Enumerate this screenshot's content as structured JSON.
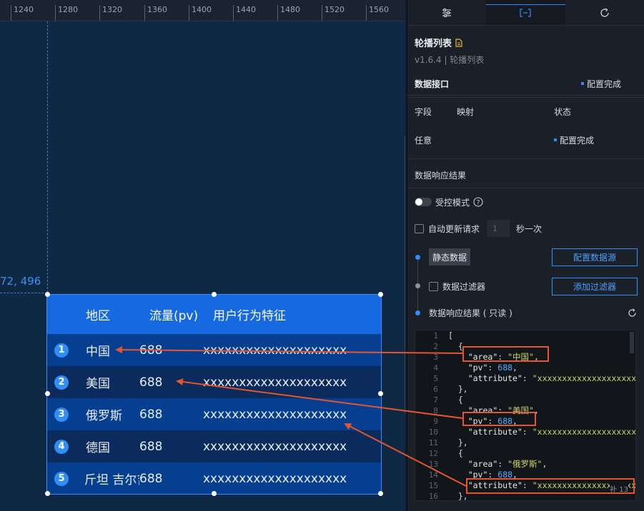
{
  "ruler": {
    "ticks": [
      "1240",
      "1280",
      "1320",
      "1360",
      "1400",
      "1440",
      "1480",
      "1520",
      "1560"
    ]
  },
  "canvas": {
    "coordinate_readout": "72, 496"
  },
  "carousel": {
    "headers": {
      "area": "地区",
      "pv": "流量(pv)",
      "attribute": "用户行为特征"
    },
    "rows": [
      {
        "index": "1",
        "area": "中国",
        "pv": "688",
        "attribute": "xxxxxxxxxxxxxxxxxxxx"
      },
      {
        "index": "2",
        "area": "美国",
        "pv": "688",
        "attribute": "xxxxxxxxxxxxxxxxxxxx"
      },
      {
        "index": "3",
        "area": "俄罗斯",
        "pv": "688",
        "attribute": "xxxxxxxxxxxxxxxxxxxx"
      },
      {
        "index": "4",
        "area": "德国",
        "pv": "688",
        "attribute": "xxxxxxxxxxxxxxxxxxxx"
      },
      {
        "index": "5",
        "area": "斤坦 吉尔吉",
        "pv": "688",
        "attribute": "xxxxxxxxxxxxxxxxxxxx"
      }
    ]
  },
  "panel": {
    "tabs": [
      {
        "name": "sliders-icon"
      },
      {
        "name": "data-bracket-icon",
        "active": true
      },
      {
        "name": "interaction-icon"
      }
    ],
    "component_title": "轮播列表",
    "component_subtitle": "v1.6.4 | 轮播列表",
    "data_interface": {
      "label": "数据接口",
      "status": "配置完成"
    },
    "field_table": {
      "headers": [
        "字段",
        "映射",
        "状态"
      ],
      "row": {
        "field": "任意",
        "status": "配置完成"
      }
    },
    "response_label": "数据响应结果",
    "controlled_mode_label": "受控模式",
    "auto_update": {
      "label": "自动更新请求",
      "value": "1",
      "suffix": "秒一次"
    },
    "steps": {
      "static_data": "静态数据",
      "configure_source_button": "配置数据源",
      "filter_label": "数据过滤器",
      "add_filter_button": "添加过滤器",
      "result_label": "数据响应结果 ( 只读 )"
    },
    "editor": {
      "line_numbers": [
        "1",
        "2",
        "3",
        "4",
        "5",
        "6",
        "7",
        "8",
        "9",
        "10",
        "11",
        "12",
        "13",
        "14",
        "15",
        "16"
      ],
      "corner_text": "补 13"
    }
  },
  "colors": {
    "accent": "#2f8ef7",
    "annotation": "#e3562e",
    "widget_header": "#1669e0"
  }
}
